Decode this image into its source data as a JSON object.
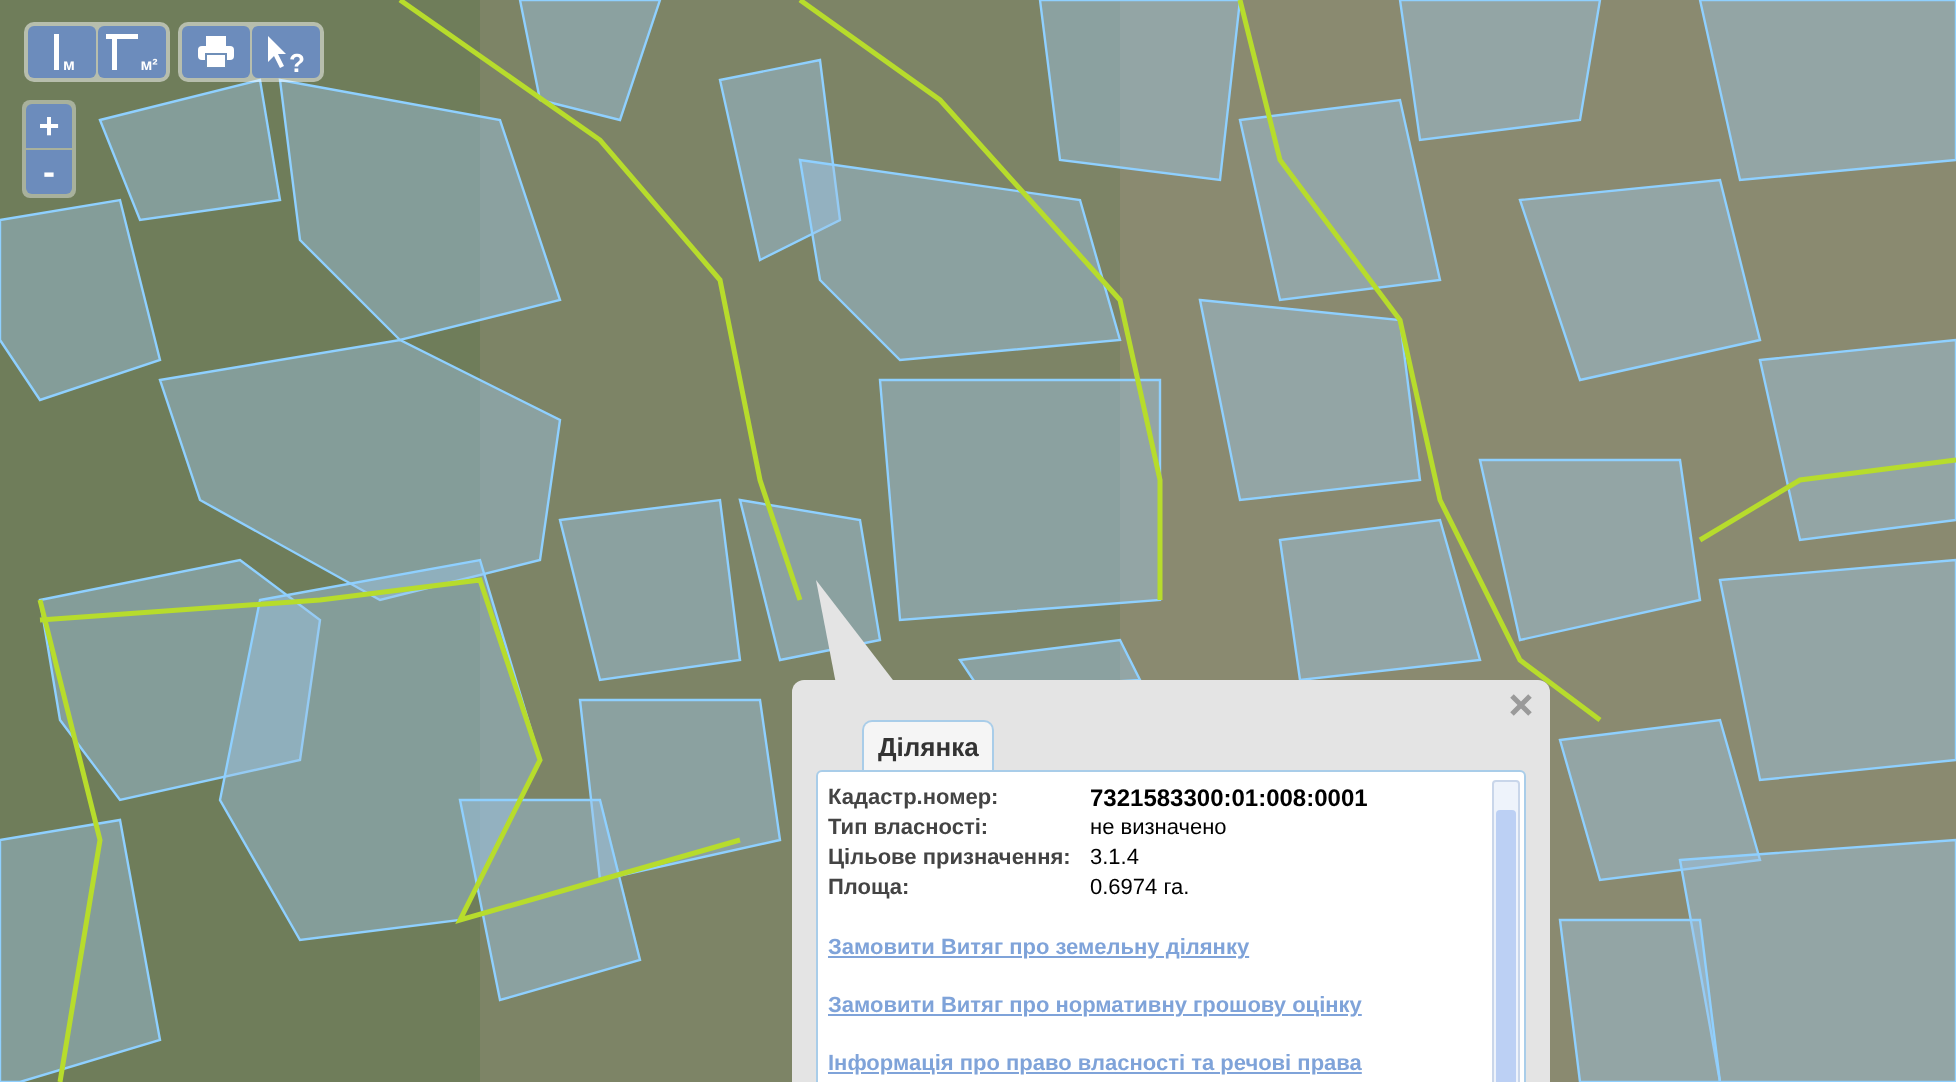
{
  "toolbar": {
    "groups": [
      [
        {
          "kind": "distance",
          "label": "м"
        },
        {
          "kind": "area",
          "label": "м²"
        }
      ],
      [
        {
          "kind": "print"
        },
        {
          "kind": "identify",
          "label": "?"
        }
      ]
    ]
  },
  "zoom": {
    "buttons": [
      "+",
      "-"
    ]
  },
  "popup": {
    "tab": "Ділянка",
    "fields": [
      {
        "label": "Кадастр.номер:",
        "value": "7321583300:01:008:0001",
        "bold": true
      },
      {
        "label": "Тип власності:",
        "value": "не визначено",
        "bold": false
      },
      {
        "label": "Цільове призначення:",
        "value": "3.1.4",
        "bold": false
      },
      {
        "label": "Площа:",
        "value": "0.6974 га.",
        "bold": false
      }
    ],
    "links": [
      "Замовити Витяг про земельну ділянку",
      "Замовити Витяг про нормативну грошову оцінку",
      "Інформація про право власності та речові права"
    ]
  }
}
